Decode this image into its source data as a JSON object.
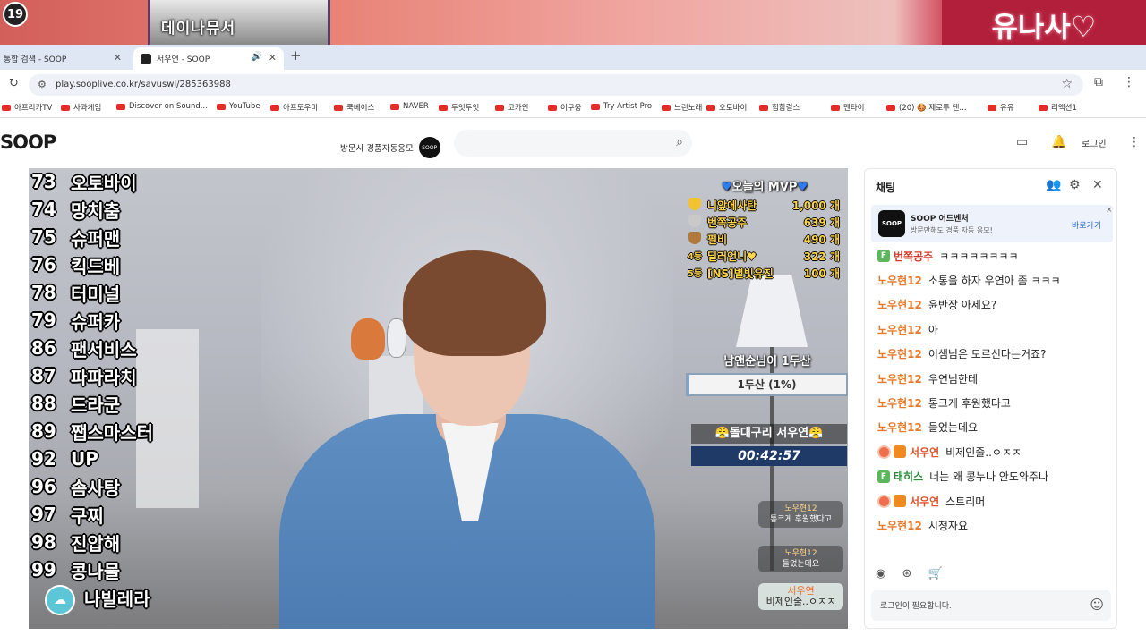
{
  "browser": {
    "top_banner": {
      "age_badge": "19",
      "left_banner_text": "데이나뮤서",
      "right_banner_text": "유나사♡"
    },
    "tabs": [
      {
        "label": "통합 검색 - SOOP",
        "active": false
      },
      {
        "label": "서우연 - SOOP",
        "active": true
      }
    ],
    "new_tab_glyph": "+",
    "url": "play.sooplive.co.kr/savuswl/285363988",
    "bookmarks": [
      "아프리카TV",
      "사과게임",
      "Discover on Sound...",
      "YouTube",
      "아프도우미",
      "쿡베이스",
      "NAVER",
      "두잇두잇",
      "코카인",
      "이쿠웅",
      "Try Artist Pro",
      "느린노래",
      "오토바이",
      "힙합걸스",
      "멘타이",
      "(20) 🍪 제로투 댄...",
      "유유",
      "리액션1"
    ]
  },
  "site": {
    "logo": "SOOP",
    "promo_text": "방문시 경품자동응모",
    "promo_badge": "SOOP",
    "search": {
      "placeholder": "",
      "value": ""
    },
    "login_label": "로그인"
  },
  "stream": {
    "donation_list": [
      {
        "num": "73",
        "name": "오토바이"
      },
      {
        "num": "74",
        "name": "망치춤"
      },
      {
        "num": "75",
        "name": "슈퍼맨"
      },
      {
        "num": "76",
        "name": "킥드베"
      },
      {
        "num": "78",
        "name": "터미널"
      },
      {
        "num": "79",
        "name": "슈퍼카"
      },
      {
        "num": "86",
        "name": "팬서비스"
      },
      {
        "num": "87",
        "name": "파파라치"
      },
      {
        "num": "88",
        "name": "드라군"
      },
      {
        "num": "89",
        "name": "쨉스마스터"
      },
      {
        "num": "92",
        "name": "UP"
      },
      {
        "num": "96",
        "name": "솜사탕"
      },
      {
        "num": "97",
        "name": "구찌"
      },
      {
        "num": "98",
        "name": "진압해"
      },
      {
        "num": "99",
        "name": "콩나물"
      },
      {
        "num": "1",
        "name": "나빌레라"
      }
    ],
    "mvp": {
      "title": "오늘의 MVP",
      "rows": [
        {
          "rank": "1",
          "name": "니앞에사탄",
          "count": "1,000 개"
        },
        {
          "rank": "2",
          "name": "번쪽공주",
          "count": "639 개"
        },
        {
          "rank": "3",
          "name": "펄비",
          "count": "490 개"
        },
        {
          "rank": "4등",
          "name": "딜러언니♥",
          "count": "322 개"
        },
        {
          "rank": "5등",
          "name": "[NS]별빛유진",
          "count": "100 개"
        }
      ]
    },
    "goal": {
      "title": "남앤순님이 1두산",
      "bar_text": "1두산 (1%)",
      "progress": 1
    },
    "timer": {
      "title": "😤돌대구리 서우연😤",
      "value": "00:42:57"
    },
    "overlay_chats": [
      {
        "name": "노우현12",
        "text": "통크게 후원했다고"
      },
      {
        "name": "노우현12",
        "text": "들었는데요"
      },
      {
        "name": "서우연",
        "text": "비제인줄..ㅇㅈㅈ"
      }
    ]
  },
  "chat": {
    "title": "채팅",
    "ad": {
      "logo": "SOOP",
      "title": "SOOP 어드벤처",
      "subtitle": "방문만해도 경품 자동 응모!",
      "button": "바로가기",
      "close": "×"
    },
    "messages": [
      {
        "user": "번쪽공주",
        "text": "ㅋㅋㅋㅋㅋㅋㅋㅋ",
        "badge": "F"
      },
      {
        "user": "노우현12",
        "text": "소통을 하자 우연아 좀 ㅋㅋㅋ",
        "badge": ""
      },
      {
        "user": "노우현12",
        "text": "윤반장 아세요?",
        "badge": ""
      },
      {
        "user": "노우현12",
        "text": "아",
        "badge": ""
      },
      {
        "user": "노우현12",
        "text": "이샘님은 모르신다는거죠?",
        "badge": ""
      },
      {
        "user": "노우현12",
        "text": "우연님한테",
        "badge": ""
      },
      {
        "user": "노우현12",
        "text": "통크게 후원했다고",
        "badge": ""
      },
      {
        "user": "노우현12",
        "text": "들었는데요",
        "badge": ""
      },
      {
        "user": "서우연",
        "text": "비제인줄..ㅇㅈㅈ",
        "badge": "S"
      },
      {
        "user": "태히스",
        "text": "너는 왜 콩누나 안도와주나",
        "badge": "F"
      },
      {
        "user": "서우연",
        "text": "스트리머",
        "badge": "S"
      },
      {
        "user": "노우현12",
        "text": "시청자요",
        "badge": ""
      }
    ],
    "input_placeholder": "로그인이 필요합니다."
  },
  "colors": {
    "accent_orange": "#e87a2c",
    "soop_dark": "#111111",
    "link_blue": "#2c69d8",
    "timer_bg": "#1f3a67"
  }
}
